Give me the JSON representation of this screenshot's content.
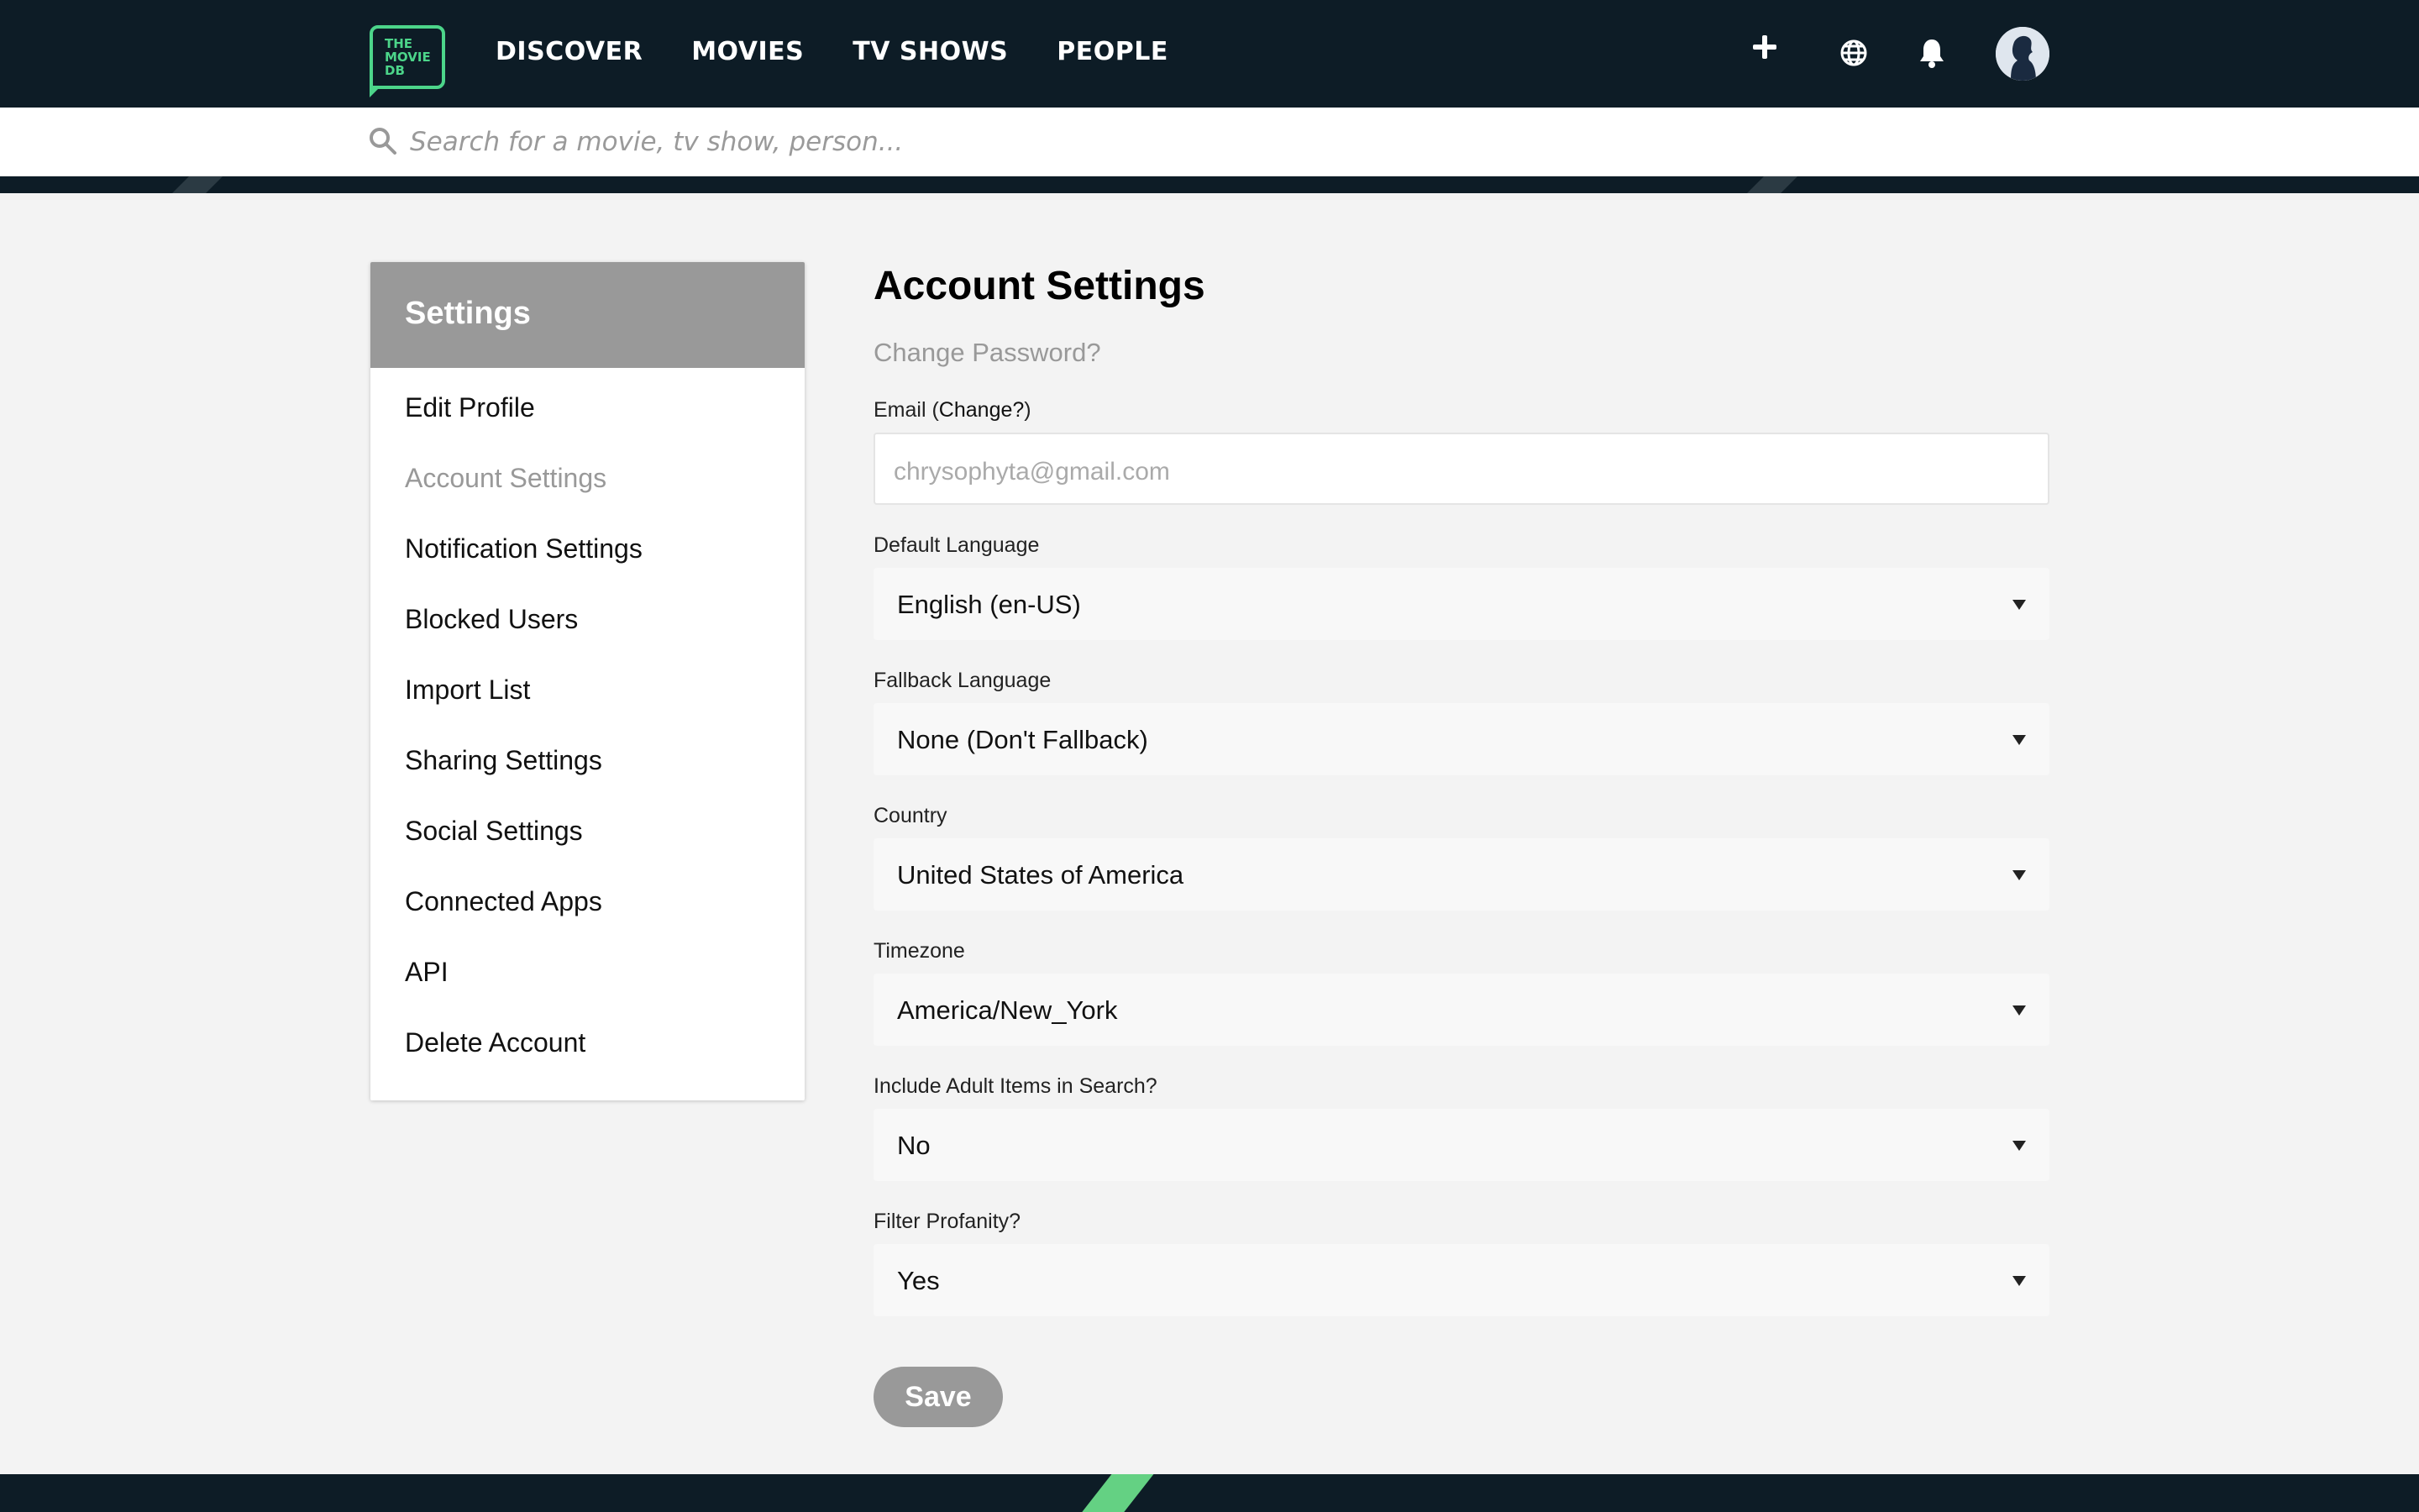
{
  "colors": {
    "header_bg": "#0d1c26",
    "brand_green": "#4cd58a",
    "sidebar_head_bg": "#999999",
    "save_button_bg": "#999999",
    "page_bg": "#f3f3f3"
  },
  "header": {
    "logo_lines": [
      "THE",
      "MOVIE",
      "DB"
    ],
    "nav": [
      "DISCOVER",
      "MOVIES",
      "TV SHOWS",
      "PEOPLE"
    ],
    "icons": [
      "plus-icon",
      "globe-icon",
      "bell-icon",
      "avatar"
    ]
  },
  "search": {
    "placeholder": "Search for a movie, tv show, person..."
  },
  "sidebar": {
    "title": "Settings",
    "items": [
      {
        "label": "Edit Profile",
        "active": false
      },
      {
        "label": "Account Settings",
        "active": true
      },
      {
        "label": "Notification Settings",
        "active": false
      },
      {
        "label": "Blocked Users",
        "active": false
      },
      {
        "label": "Import List",
        "active": false
      },
      {
        "label": "Sharing Settings",
        "active": false
      },
      {
        "label": "Social Settings",
        "active": false
      },
      {
        "label": "Connected Apps",
        "active": false
      },
      {
        "label": "API",
        "active": false
      },
      {
        "label": "Delete Account",
        "active": false
      }
    ]
  },
  "main": {
    "title": "Account Settings",
    "change_password": "Change Password?",
    "email": {
      "label_prefix": "Email (",
      "label_link": "Change?",
      "label_suffix": ")",
      "value": "chrysophyta@gmail.com"
    },
    "fields": [
      {
        "label": "Default Language",
        "value": "English (en-US)"
      },
      {
        "label": "Fallback Language",
        "value": "None (Don't Fallback)"
      },
      {
        "label": "Country",
        "value": "United States of America"
      },
      {
        "label": "Timezone",
        "value": "America/New_York"
      },
      {
        "label": "Include Adult Items in Search?",
        "value": "No"
      },
      {
        "label": "Filter Profanity?",
        "value": "Yes"
      }
    ],
    "save_label": "Save"
  }
}
